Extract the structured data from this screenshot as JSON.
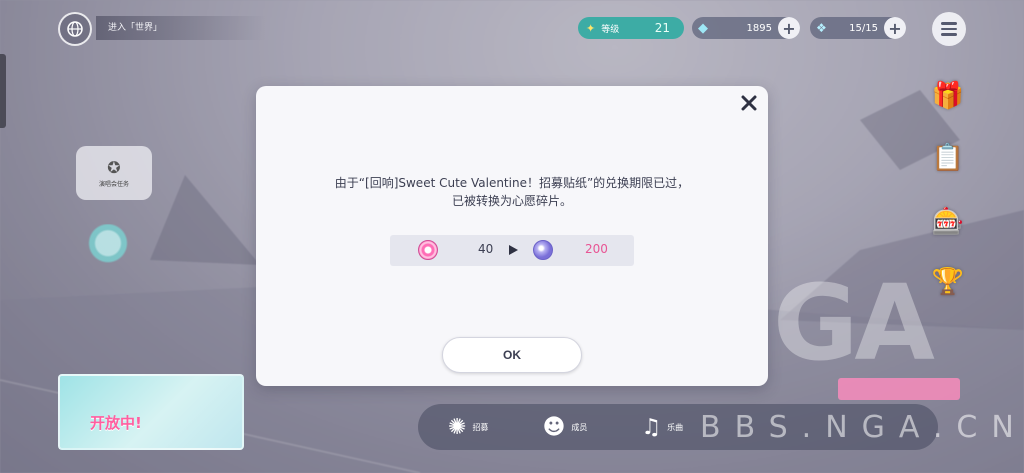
{
  "top_bar": {
    "location_text": "进入「世界」",
    "level_label": "等级",
    "level_value": "21",
    "gems_value": "1895",
    "stamina_value": "15/15"
  },
  "side_event": {
    "label": "演唱会任务"
  },
  "banner": {
    "title": "开放中!"
  },
  "bottom_nav": {
    "items": [
      {
        "label": "招募"
      },
      {
        "label": "成员"
      },
      {
        "label": "乐曲"
      }
    ]
  },
  "watermark": {
    "text": "BBS.NGA.CN",
    "logo": "NGA"
  },
  "dialog": {
    "message_line1": "由于“[回响]Sweet Cute Valentine！招募贴纸”的兑换期限已过，",
    "message_line2": "已被转换为心愿碎片。",
    "exchange": {
      "from_qty": "40",
      "to_qty": "200",
      "from_icon": "pink-disc-icon",
      "to_icon": "purple-shard-icon",
      "arrow_icon": "play-arrow-icon"
    },
    "ok_label": "OK",
    "accent_color": "#e85594"
  },
  "colors": {
    "level_pill": "#28aaa0",
    "dialog_bg": "#f7f7fa",
    "text": "#3c3f52"
  }
}
